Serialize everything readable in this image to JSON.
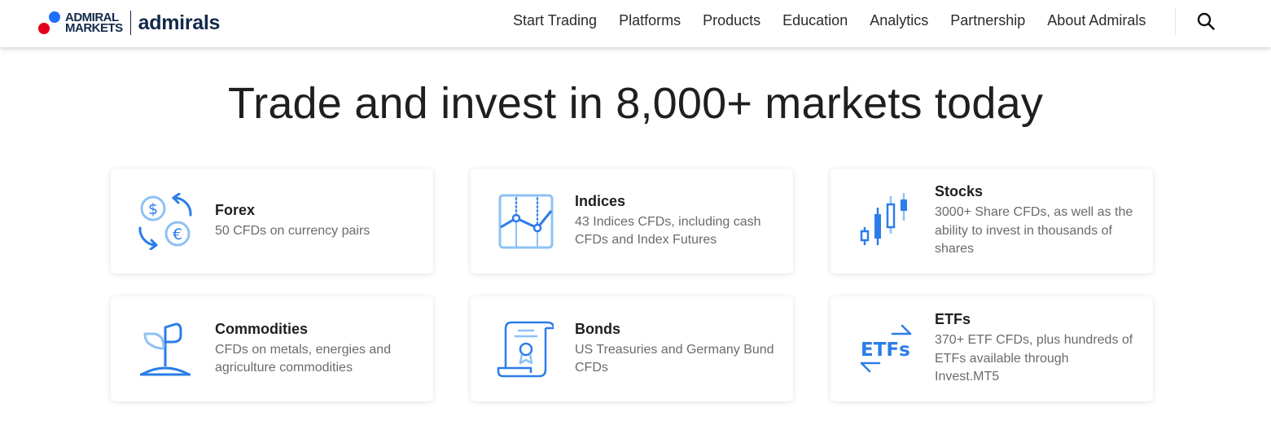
{
  "header": {
    "logo": {
      "wordmark_line1": "ADMIRAL",
      "wordmark_line2": "MARKETS",
      "brand": "admirals"
    },
    "nav": [
      {
        "id": "start-trading",
        "label": "Start Trading"
      },
      {
        "id": "platforms",
        "label": "Platforms"
      },
      {
        "id": "products",
        "label": "Products"
      },
      {
        "id": "education",
        "label": "Education"
      },
      {
        "id": "analytics",
        "label": "Analytics"
      },
      {
        "id": "partnership",
        "label": "Partnership"
      },
      {
        "id": "about-admirals",
        "label": "About Admirals"
      }
    ],
    "search_icon": "search-icon"
  },
  "main": {
    "title": "Trade and invest in 8,000+ markets today",
    "cards": [
      {
        "title": "Forex",
        "description": "50 CFDs on currency pairs",
        "icon": "currency-exchange-icon"
      },
      {
        "title": "Indices",
        "description": "43 Indices CFDs, including cash CFDs and Index Futures",
        "icon": "index-chart-icon"
      },
      {
        "title": "Stocks",
        "description": "3000+ Share CFDs, as well as the ability to invest in thousands of shares",
        "icon": "candlestick-icon"
      },
      {
        "title": "Commodities",
        "description": "CFDs on metals, energies and agriculture commodities",
        "icon": "plant-sprout-icon"
      },
      {
        "title": "Bonds",
        "description": "US Treasuries and Germany Bund CFDs",
        "icon": "certificate-scroll-icon"
      },
      {
        "title": "ETFs",
        "description": "370+ ETF CFDs, plus hundreds of ETFs available through Invest.MT5",
        "icon": "etf-arrows-icon",
        "icon_text": "ETFs"
      }
    ]
  },
  "colors": {
    "accent_blue": "#1f6fff",
    "icon_blue": "#2b7de9",
    "icon_light_blue": "#8ec1f5",
    "brand_navy": "#13294b",
    "brand_red": "#e3001b"
  }
}
